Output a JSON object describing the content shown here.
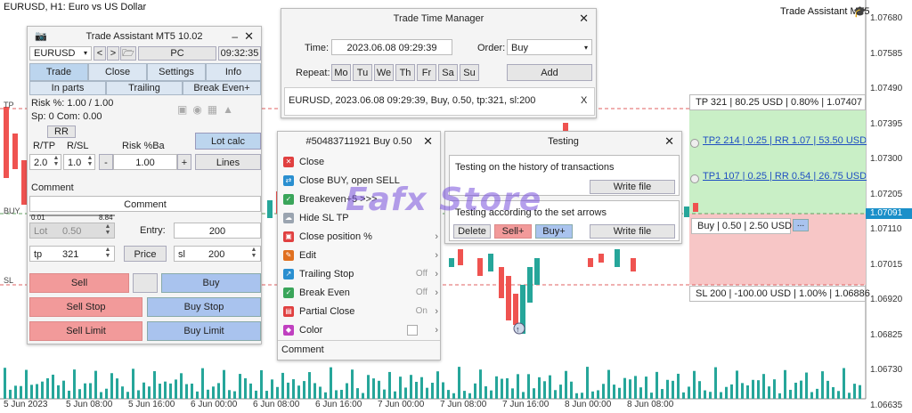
{
  "chart": {
    "title": "EURUSD, H1:  Euro vs US Dollar",
    "ea_name": "Trade Assistant MT5",
    "price_ticks": [
      "1.07680",
      "1.07585",
      "1.07490",
      "1.07395",
      "1.07300",
      "1.07205",
      "1.07110",
      "1.07015",
      "1.06920",
      "1.06825",
      "1.06730",
      "1.06635"
    ],
    "current_price": "1.07091",
    "time_ticks": [
      "5 Jun 2023",
      "5 Jun 08:00",
      "5 Jun 16:00",
      "6 Jun 00:00",
      "6 Jun 08:00",
      "6 Jun 16:00",
      "7 Jun 00:00",
      "7 Jun 08:00",
      "7 Jun 16:00",
      "8 Jun 00:00",
      "8 Jun 08:00"
    ],
    "level_labels": {
      "tp": "TP",
      "buy": "BUY",
      "sl": "SL"
    }
  },
  "trade_assistant": {
    "title": "Trade Assistant MT5 10.02",
    "symbol": "EURUSD",
    "nav_prev": "<",
    "nav_next": ">",
    "mode": "PC",
    "time": "09:32:35",
    "tabs": [
      "Trade",
      "Close",
      "Settings",
      "Info"
    ],
    "subtabs": [
      "In parts",
      "Trailing",
      "Break Even+"
    ],
    "risk_text": "Risk %: 1.00 /  1.00",
    "sp_text": "Sp: 0  Com: 0.00",
    "rr_label": "RR",
    "rtp_label": "R/TP",
    "rsl_label": "R/SL",
    "risk_ba_label": "Risk %Ba",
    "lot_calc": "Lot calc",
    "rtp_value": "2.0",
    "rsl_value": "1.0",
    "minus": "-",
    "plus": "+",
    "risk_value": "1.00",
    "lines": "Lines",
    "comment_label": "Comment",
    "comment_value": "Comment",
    "slider_min": "0.01",
    "slider_max": "8.84",
    "lot_label": "Lot",
    "lot_value": "0.50",
    "entry_label": "Entry:",
    "entry_value": "200",
    "tp_label": "tp",
    "tp_value": "321",
    "price_btn": "Price",
    "sl_label": "sl",
    "sl_value": "200",
    "sell": "Sell",
    "buy": "Buy",
    "sell_stop": "Sell Stop",
    "buy_stop": "Buy Stop",
    "sell_limit": "Sell Limit",
    "buy_limit": "Buy Limit"
  },
  "time_manager": {
    "title": "Trade Time Manager",
    "time_label": "Time:",
    "time_value": "2023.06.08 09:29:39",
    "order_label": "Order:",
    "order_value": "Buy",
    "repeat_label": "Repeat:",
    "days": [
      "Mo",
      "Tu",
      "We",
      "Th",
      "Fr",
      "Sa",
      "Su"
    ],
    "add": "Add",
    "entry": "EURUSD, 2023.06.08 09:29:39, Buy, 0.50, tp:321, sl:200",
    "entry_close": "X"
  },
  "order_menu": {
    "title": "#50483711921 Buy 0.50",
    "items": [
      {
        "label": "Close",
        "color": "#e04040",
        "glyph": "✕",
        "extra": "",
        "arrow": ""
      },
      {
        "label": "Close BUY, open SELL",
        "color": "#2a8fd0",
        "glyph": "⇄",
        "extra": "",
        "arrow": ""
      },
      {
        "label": "Breakeven+5 >>>",
        "color": "#3aa55a",
        "glyph": "✓",
        "extra": "",
        "arrow": ""
      },
      {
        "label": "Hide SL TP",
        "color": "#9aa4b0",
        "glyph": "☁",
        "extra": "",
        "arrow": ""
      },
      {
        "label": "Close position %",
        "color": "#e04040",
        "glyph": "▣",
        "extra": "",
        "arrow": "›"
      },
      {
        "label": "Edit",
        "color": "#e07020",
        "glyph": "✎",
        "extra": "",
        "arrow": "›"
      },
      {
        "label": "Trailing Stop",
        "color": "#2a8fd0",
        "glyph": "↗",
        "extra": "Off",
        "arrow": "›"
      },
      {
        "label": "Break Even",
        "color": "#3aa55a",
        "glyph": "✓",
        "extra": "Off",
        "arrow": "›"
      },
      {
        "label": "Partial Close",
        "color": "#e04040",
        "glyph": "▤",
        "extra": "On",
        "arrow": "›"
      },
      {
        "label": "Color",
        "color": "#c040c0",
        "glyph": "◆",
        "extra": "",
        "arrow": "›"
      }
    ],
    "comment": "Comment"
  },
  "testing": {
    "title": "Testing",
    "history_text": "Testing on the history of transactions",
    "write_file_1": "Write file",
    "arrows_text": "Testing according to the set arrows",
    "delete": "Delete",
    "sell_plus": "Sell+",
    "buy_plus": "Buy+",
    "write_file_2": "Write file"
  },
  "levels": {
    "tp": "TP 321 | 80.25 USD | 0.80% | 1.07407",
    "tp2": "TP2 214 | 0.25 | RR 1.07 | 53.50 USD",
    "tp1": "TP1 107 | 0.25 | RR 0.54 | 26.75 USD",
    "buy": "Buy | 0.50 | 2.50 USD",
    "buy_more": "...",
    "sl": "SL 200 | -100.00 USD | 1.00% | 1.06886"
  },
  "watermark": "Eafx Store"
}
